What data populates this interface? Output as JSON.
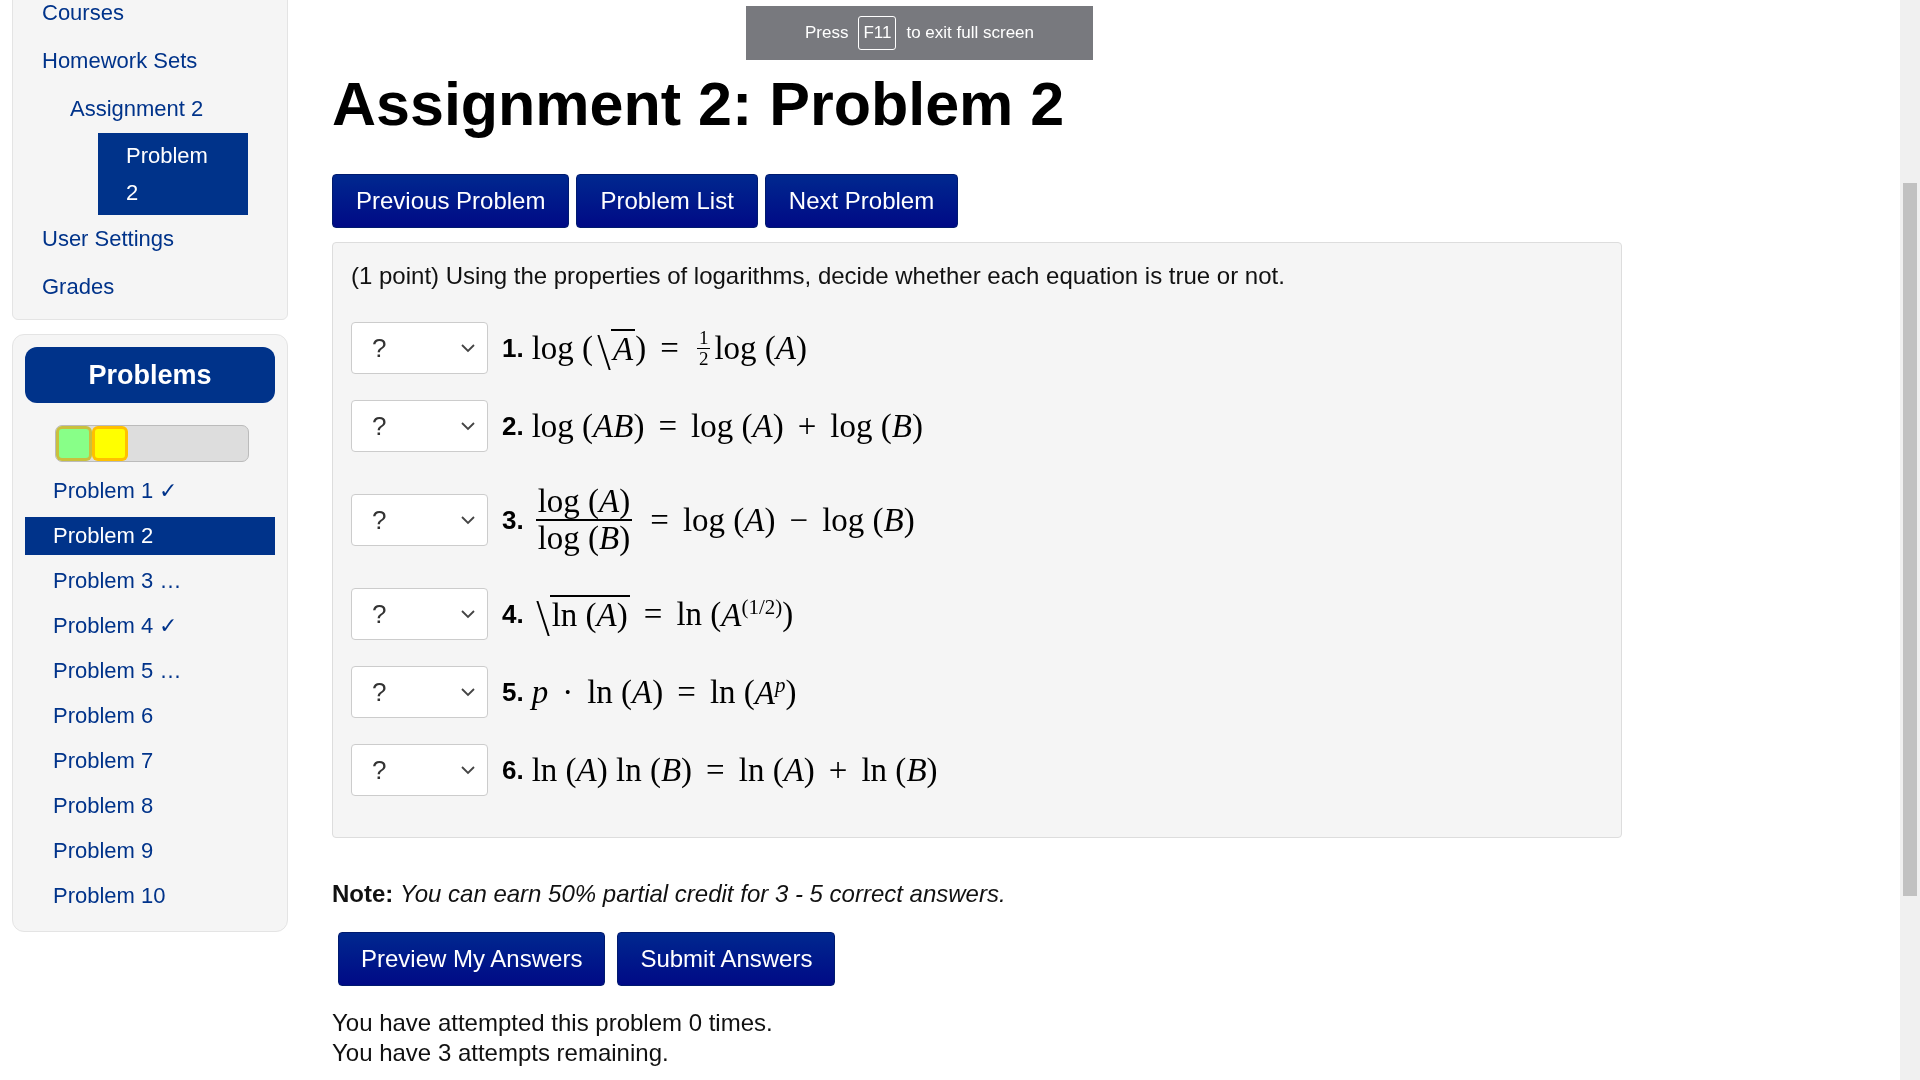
{
  "sidebar": {
    "nav": [
      {
        "label": "Courses",
        "selected": false
      },
      {
        "label": "Homework Sets",
        "selected": false,
        "children": [
          {
            "label": "Assignment 2",
            "selected": false,
            "children": [
              {
                "label": "Problem 2",
                "selected": true
              }
            ]
          }
        ]
      },
      {
        "label": "User Settings",
        "selected": false
      },
      {
        "label": "Grades",
        "selected": false
      }
    ],
    "problems_panel": {
      "title": "Problems",
      "status_segments": [
        {
          "color": "#88ff88"
        },
        {
          "color": "#ffff00"
        }
      ],
      "items": [
        {
          "label": "Problem 1 ✓",
          "selected": false
        },
        {
          "label": "Problem 2",
          "selected": true
        },
        {
          "label": "Problem 3 …",
          "selected": false
        },
        {
          "label": "Problem 4 ✓",
          "selected": false
        },
        {
          "label": "Problem 5 …",
          "selected": false
        },
        {
          "label": "Problem 6",
          "selected": false
        },
        {
          "label": "Problem 7",
          "selected": false
        },
        {
          "label": "Problem 8",
          "selected": false
        },
        {
          "label": "Problem 9",
          "selected": false
        },
        {
          "label": "Problem 10",
          "selected": false
        }
      ]
    }
  },
  "title": "Assignment 2: Problem 2",
  "fullscreen_toast": {
    "before": "Press",
    "key": "F11",
    "after": "to exit full screen"
  },
  "nav_buttons": [
    "Previous Problem",
    "Problem List",
    "Next Problem"
  ],
  "problem": {
    "prompt": "(1 point) Using the properties of logarithms, decide whether each equation is true or not.",
    "items": [
      {
        "answer": "?",
        "number": "1.",
        "equation": [
          {
            "kind": "t",
            "text": "log ("
          },
          {
            "kind": "sqrt",
            "body": [
              {
                "kind": "v",
                "text": "A"
              }
            ]
          },
          {
            "kind": "t",
            "text": ")"
          },
          {
            "kind": "rel",
            "text": "="
          },
          {
            "kind": "frac",
            "small": true,
            "num": [
              {
                "kind": "t",
                "text": "1"
              }
            ],
            "den": [
              {
                "kind": "t",
                "text": "2"
              }
            ]
          },
          {
            "kind": "t",
            "text": "log ("
          },
          {
            "kind": "v",
            "text": "A"
          },
          {
            "kind": "t",
            "text": ")"
          }
        ]
      },
      {
        "answer": "?",
        "number": "2.",
        "equation": [
          {
            "kind": "t",
            "text": "log ("
          },
          {
            "kind": "v",
            "text": "AB"
          },
          {
            "kind": "t",
            "text": ")"
          },
          {
            "kind": "rel",
            "text": "="
          },
          {
            "kind": "t",
            "text": "log ("
          },
          {
            "kind": "v",
            "text": "A"
          },
          {
            "kind": "t",
            "text": ")"
          },
          {
            "kind": "rel",
            "text": "+"
          },
          {
            "kind": "t",
            "text": "log ("
          },
          {
            "kind": "v",
            "text": "B"
          },
          {
            "kind": "t",
            "text": ")"
          }
        ]
      },
      {
        "answer": "?",
        "number": "3.",
        "equation": [
          {
            "kind": "frac",
            "small": false,
            "num": [
              {
                "kind": "t",
                "text": "log ("
              },
              {
                "kind": "v",
                "text": "A"
              },
              {
                "kind": "t",
                "text": ")"
              }
            ],
            "den": [
              {
                "kind": "t",
                "text": "log ("
              },
              {
                "kind": "v",
                "text": "B"
              },
              {
                "kind": "t",
                "text": ")"
              }
            ]
          },
          {
            "kind": "rel",
            "text": "="
          },
          {
            "kind": "t",
            "text": "log ("
          },
          {
            "kind": "v",
            "text": "A"
          },
          {
            "kind": "t",
            "text": ")"
          },
          {
            "kind": "rel",
            "text": "−"
          },
          {
            "kind": "t",
            "text": "log ("
          },
          {
            "kind": "v",
            "text": "B"
          },
          {
            "kind": "t",
            "text": ")"
          }
        ]
      },
      {
        "answer": "?",
        "number": "4.",
        "equation": [
          {
            "kind": "sqrt",
            "body": [
              {
                "kind": "t",
                "text": "ln ("
              },
              {
                "kind": "v",
                "text": "A"
              },
              {
                "kind": "t",
                "text": ")"
              }
            ]
          },
          {
            "kind": "rel",
            "text": "="
          },
          {
            "kind": "t",
            "text": "ln ("
          },
          {
            "kind": "sup",
            "base": [
              {
                "kind": "v",
                "text": "A"
              }
            ],
            "exp": [
              {
                "kind": "t",
                "text": "(1/2)"
              }
            ]
          },
          {
            "kind": "t",
            "text": ")"
          }
        ]
      },
      {
        "answer": "?",
        "number": "5.",
        "equation": [
          {
            "kind": "v",
            "text": "p"
          },
          {
            "kind": "rel",
            "text": "·"
          },
          {
            "kind": "t",
            "text": "ln ("
          },
          {
            "kind": "v",
            "text": "A"
          },
          {
            "kind": "t",
            "text": ")"
          },
          {
            "kind": "rel",
            "text": "="
          },
          {
            "kind": "t",
            "text": "ln ("
          },
          {
            "kind": "sup",
            "base": [
              {
                "kind": "v",
                "text": "A"
              }
            ],
            "exp": [
              {
                "kind": "v",
                "text": "p"
              }
            ]
          },
          {
            "kind": "t",
            "text": ")"
          }
        ]
      },
      {
        "answer": "?",
        "number": "6.",
        "equation": [
          {
            "kind": "t",
            "text": "ln ("
          },
          {
            "kind": "v",
            "text": "A"
          },
          {
            "kind": "t",
            "text": ") ln ("
          },
          {
            "kind": "v",
            "text": "B"
          },
          {
            "kind": "t",
            "text": ")"
          },
          {
            "kind": "rel",
            "text": "="
          },
          {
            "kind": "t",
            "text": "ln ("
          },
          {
            "kind": "v",
            "text": "A"
          },
          {
            "kind": "t",
            "text": ")"
          },
          {
            "kind": "rel",
            "text": "+"
          },
          {
            "kind": "t",
            "text": "ln ("
          },
          {
            "kind": "v",
            "text": "B"
          },
          {
            "kind": "t",
            "text": ")"
          }
        ]
      }
    ]
  },
  "note": "**Note:** *You can earn 50% partial credit for 3 - 5 correct answers.*",
  "action_buttons": [
    "Preview My Answers",
    "Submit Answers"
  ],
  "attempts": [
    "You have attempted this problem 0 times.",
    "You have 3 attempts remaining."
  ]
}
